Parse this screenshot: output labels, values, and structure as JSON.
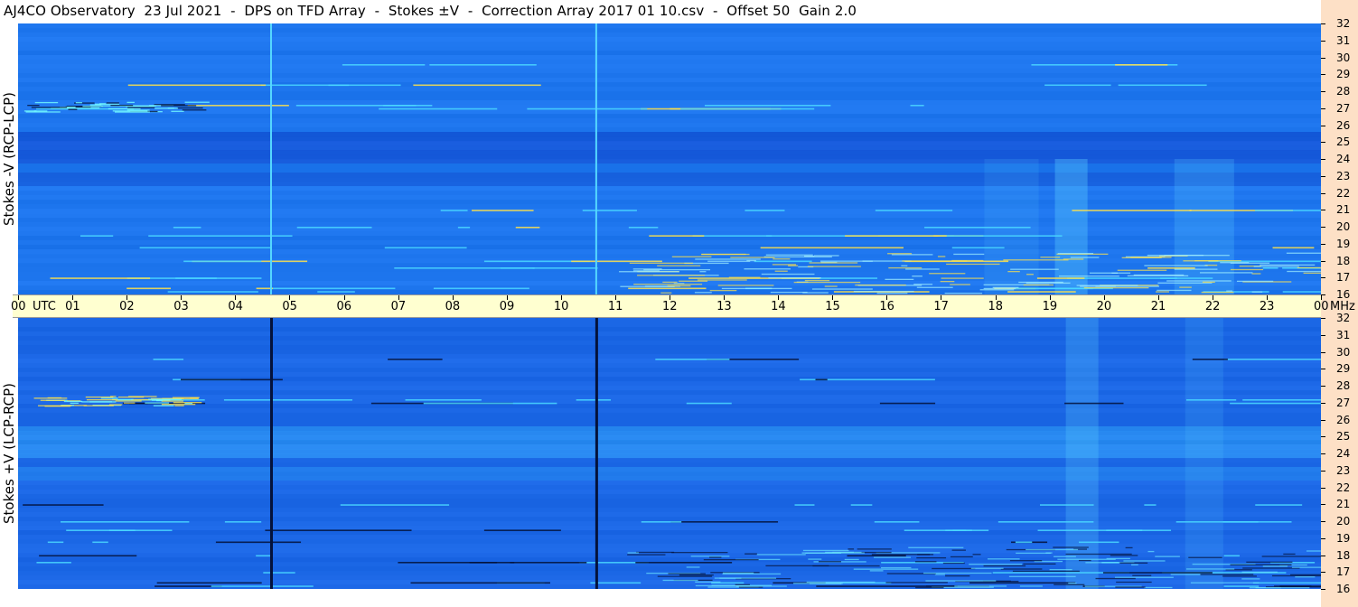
{
  "title": "AJ4CO Observatory  23 Jul 2021  -  DPS on TFD Array  -  Stokes ±V  -  Correction Array 2017 01 10.csv  -  Offset 50  Gain 2.0",
  "colors": {
    "background_panel": "#1e6ee8",
    "utc_bar": "#ffffd0",
    "right_strip": "#fde0c6",
    "interference_cyan": "#4ad7ff",
    "interference_yellow": "#ffe24a",
    "dropout_dark": "#04123a"
  },
  "chart_data": [
    {
      "type": "heatmap",
      "title": "Stokes -V (RCP-LCP)",
      "ylabel": "Stokes -V (RCP-LCP)",
      "x_unit": "UTC",
      "y_unit": "MHz",
      "x_range": [
        0,
        24
      ],
      "y_range": [
        16,
        32
      ],
      "y_ticks": [
        "32",
        "31",
        "30",
        "29",
        "28",
        "27",
        "26",
        "25",
        "24",
        "23",
        "22",
        "21",
        "20",
        "19",
        "18",
        "17",
        "16"
      ],
      "vertical_lines_utc": [
        4.66,
        10.65
      ],
      "vertical_line_style": "bright"
    },
    {
      "type": "heatmap",
      "title": "Stokes +V (LCP-RCP)",
      "ylabel": "Stokes +V (LCP-RCP)",
      "x_unit": "UTC",
      "y_unit": "MHz",
      "x_range": [
        0,
        24
      ],
      "y_range": [
        16,
        32
      ],
      "y_ticks": [
        "32",
        "31",
        "30",
        "29",
        "28",
        "27",
        "26",
        "25",
        "24",
        "23",
        "22",
        "21",
        "20",
        "19",
        "18",
        "17",
        "16"
      ],
      "vertical_lines_utc": [
        4.66,
        10.65
      ],
      "vertical_line_style": "dark"
    }
  ],
  "utc_axis": {
    "ticks": [
      "00",
      "01",
      "02",
      "03",
      "04",
      "05",
      "06",
      "07",
      "08",
      "09",
      "10",
      "11",
      "12",
      "13",
      "14",
      "15",
      "16",
      "17",
      "18",
      "19",
      "20",
      "21",
      "22",
      "23",
      "00"
    ],
    "utc_label": "UTC",
    "mhz_label": "MHz"
  }
}
